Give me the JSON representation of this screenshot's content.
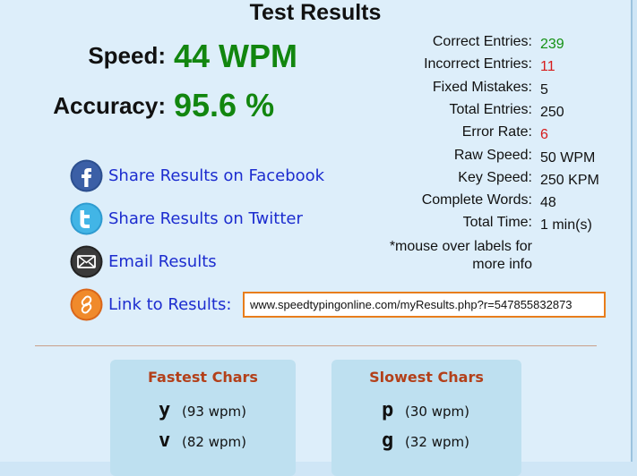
{
  "title": "Test Results",
  "speed": {
    "label": "Speed:",
    "value": "44 WPM"
  },
  "accuracy": {
    "label": "Accuracy:",
    "value": "95.6 %"
  },
  "share": {
    "facebook": "Share Results on Facebook",
    "twitter": "Share Results on Twitter",
    "email": "Email Results",
    "link": "Link to Results:"
  },
  "result_url": "www.speedtypingonline.com/myResults.php?r=547855832873",
  "stats": [
    {
      "label": "Correct Entries:",
      "value": "239",
      "color": "#139113"
    },
    {
      "label": "Incorrect Entries:",
      "value": "11",
      "color": "#d61b1b"
    },
    {
      "label": "Fixed Mistakes:",
      "value": "5",
      "color": "#111111"
    },
    {
      "label": "Total Entries:",
      "value": "250",
      "color": "#111111"
    },
    {
      "label": "Error Rate:",
      "value": "6",
      "color": "#d61b1b"
    },
    {
      "label": "Raw Speed:",
      "value": "50 WPM",
      "color": "#111111"
    },
    {
      "label": "Key Speed:",
      "value": "250 KPM",
      "color": "#111111"
    },
    {
      "label": "Complete Words:",
      "value": "48",
      "color": "#111111"
    },
    {
      "label": "Total Time:",
      "value": "1 min(s)",
      "color": "#111111"
    }
  ],
  "note_line1": "*mouse over labels for",
  "note_line2": "more info",
  "fastest": {
    "title": "Fastest Chars",
    "items": [
      {
        "char": "y",
        "speed": "(93 wpm)"
      },
      {
        "char": "v",
        "speed": "(82 wpm)"
      }
    ]
  },
  "slowest": {
    "title": "Slowest Chars",
    "items": [
      {
        "char": "p",
        "speed": "(30 wpm)"
      },
      {
        "char": "g",
        "speed": "(32 wpm)"
      }
    ]
  },
  "colors": {
    "accent_green": "#12860f",
    "link_blue": "#1c2ccf",
    "error_red": "#d61b1b",
    "title_orange": "#b3401a",
    "url_border": "#e87d1b"
  }
}
